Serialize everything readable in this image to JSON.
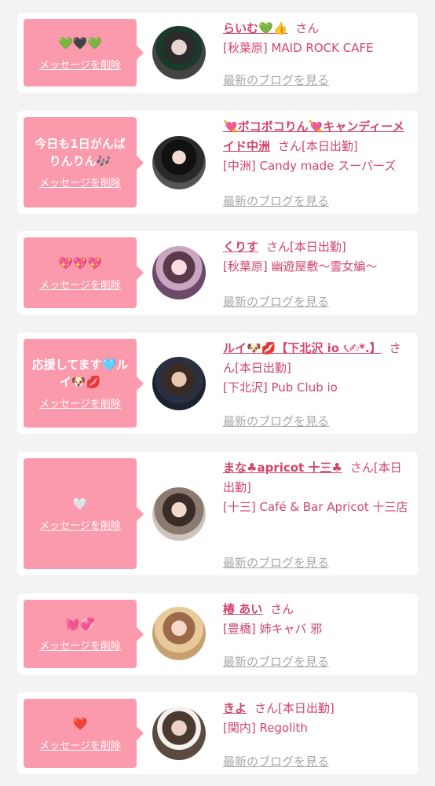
{
  "entries": [
    {
      "message": "💚🖤💚",
      "delete_label": "メッセージを削除",
      "name": "らいむ💚👍",
      "suffix": "さん",
      "location": "[秋葉原] MAID ROCK CAFE",
      "blog_label": "最新のブログを見る"
    },
    {
      "message": "今日も1日がんばりんりん🎶",
      "delete_label": "メッセージを削除",
      "name": "💘ボコボコりん💘キャンディーメイド中洲",
      "suffix": "さん[本日出勤]",
      "location": "[中洲] Candy made スーパーズ",
      "blog_label": "最新のブログを見る"
    },
    {
      "message": "💖💖💖",
      "delete_label": "メッセージを削除",
      "name": "くりす",
      "suffix": "さん[本日出勤]",
      "location": "[秋葉原] 幽遊屋敷〜霊女編〜",
      "blog_label": "最新のブログを見る"
    },
    {
      "message": "応援してます🩵ルイ🐶💋",
      "delete_label": "メッセージを削除",
      "name": "ルイ🐶💋【下北沢 io ৻✍︎*.】",
      "suffix": "さん[本日出勤]",
      "location": "[下北沢] Pub Club io",
      "blog_label": "最新のブログを見る"
    },
    {
      "message": "🤍",
      "delete_label": "メッセージを削除",
      "name": "まな♣apricot 十三♣",
      "suffix": "さん[本日出勤]",
      "location": "[十三] Café & Bar Apricot 十三店",
      "blog_label": "最新のブログを見る"
    },
    {
      "message": "💓💞",
      "delete_label": "メッセージを削除",
      "name": "椿 あい",
      "suffix": "さん",
      "location": "[豊橋] 姉キャバ 邪",
      "blog_label": "最新のブログを見る"
    },
    {
      "message": "❤️",
      "delete_label": "メッセージを削除",
      "name": "きよ",
      "suffix": "さん[本日出勤]",
      "location": "[関内] Regolith",
      "blog_label": "最新のブログを見る"
    }
  ],
  "colors": {
    "bubble": "#fb9aac",
    "accent": "#d2456a",
    "muted": "#a7a7a7",
    "background": "#f3f3f3"
  }
}
